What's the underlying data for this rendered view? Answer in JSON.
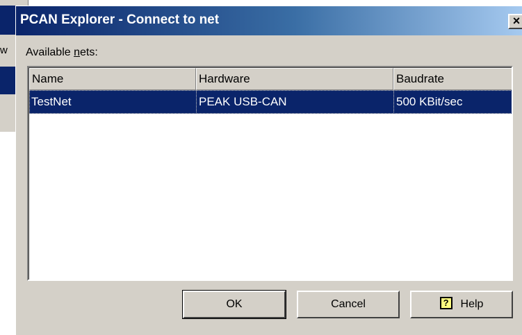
{
  "background_window": {
    "partial_text": "w"
  },
  "dialog": {
    "title": "PCAN Explorer - Connect to net",
    "close_glyph": "×",
    "available_label_prefix": "Available ",
    "available_label_mnemonic": "n",
    "available_label_suffix": "ets:"
  },
  "nets_table": {
    "columns": [
      "Name",
      "Hardware",
      "Baudrate"
    ],
    "rows": [
      {
        "name": "TestNet",
        "hardware": "PEAK USB-CAN",
        "baudrate": "500 KBit/sec",
        "selected": true
      }
    ]
  },
  "buttons": {
    "ok": "OK",
    "cancel": "Cancel",
    "help": "Help",
    "help_icon": "?"
  },
  "colors": {
    "title_bar": "#0a246a",
    "selection": "#0a246a",
    "face": "#d4d0c8"
  }
}
